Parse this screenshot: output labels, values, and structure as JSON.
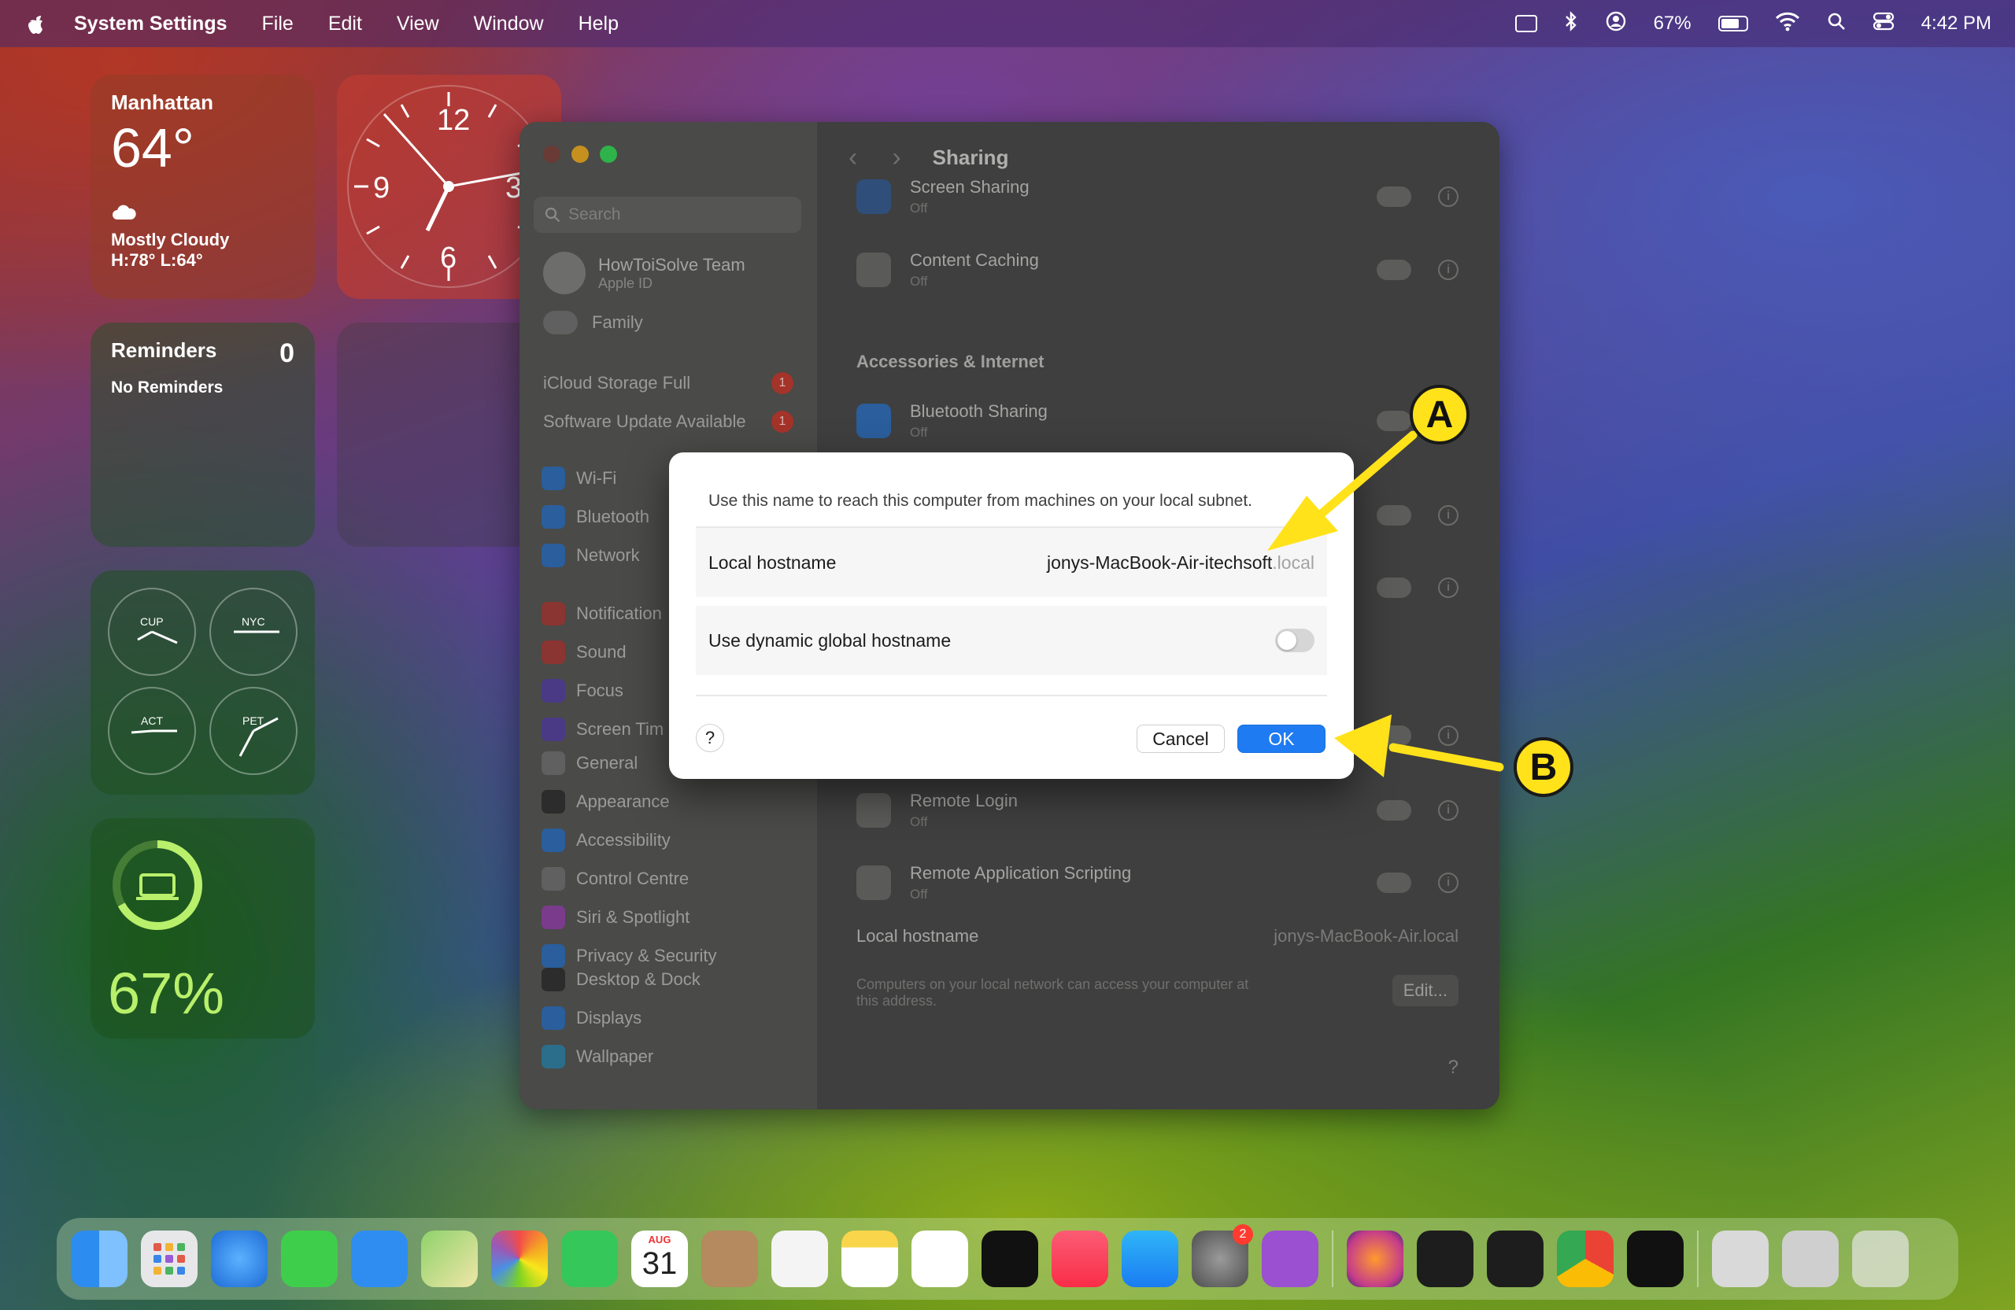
{
  "menubar": {
    "app_name": "System Settings",
    "menus": [
      "File",
      "Edit",
      "View",
      "Window",
      "Help"
    ],
    "battery_percent": "67%",
    "time": "4:42 PM"
  },
  "widgets": {
    "weather": {
      "city": "Manhattan",
      "temp": "64°",
      "condition": "Mostly Cloudy",
      "hilo": "H:78° L:64°"
    },
    "clock": {
      "labels": [
        "12",
        "9",
        "6",
        "3"
      ]
    },
    "reminders": {
      "title": "Reminders",
      "count": "0",
      "empty": "No Reminders"
    },
    "world_clocks": [
      "CUP",
      "NYC",
      "ACT",
      "PET"
    ],
    "battery": {
      "percent": "67%"
    }
  },
  "settings": {
    "search_placeholder": "Search",
    "account_name": "HowToiSolve Team",
    "account_sub": "Apple ID",
    "family": "Family",
    "notices": [
      {
        "label": "iCloud Storage Full",
        "badge": "1"
      },
      {
        "label": "Software Update Available",
        "badge": "1"
      }
    ],
    "nav_group1": [
      "Wi-Fi",
      "Bluetooth",
      "Network"
    ],
    "nav_group2": [
      "Notification",
      "Sound",
      "Focus",
      "Screen Tim"
    ],
    "nav_group3": [
      "General",
      "Appearance",
      "Accessibility",
      "Control Centre",
      "Siri & Spotlight",
      "Privacy & Security"
    ],
    "nav_group4": [
      "Desktop & Dock",
      "Displays",
      "Wallpaper"
    ],
    "page_title": "Sharing",
    "rows": {
      "screen_sharing": "Screen Sharing",
      "content_caching": "Content Caching",
      "bluetooth_sharing": "Bluetooth Sharing",
      "remote_login": "Remote Login",
      "remote_app_scripting": "Remote Application Scripting",
      "off": "Off"
    },
    "section_accessories": "Accessories & Internet",
    "footer_label": "Local hostname",
    "footer_value": "jonys-MacBook-Air.local",
    "footer_desc_1": "Computers on your local network can access your computer at",
    "footer_desc_2": "this address.",
    "edit": "Edit...",
    "help": "?"
  },
  "dialog": {
    "description": "Use this name to reach this computer from machines on your local subnet.",
    "hostname_label": "Local hostname",
    "hostname_value": "jonys-MacBook-Air-itechsoft",
    "hostname_suffix": ".local",
    "dynamic_label": "Use dynamic global hostname",
    "dynamic_on": false,
    "help": "?",
    "cancel": "Cancel",
    "ok": "OK"
  },
  "callouts": {
    "a": "A",
    "b": "B"
  },
  "dock": {
    "calendar_month": "AUG",
    "calendar_day": "31",
    "settings_badge": "2"
  },
  "colors": {
    "accent": "#1f7bf2",
    "annotation": "#ffe21a"
  }
}
